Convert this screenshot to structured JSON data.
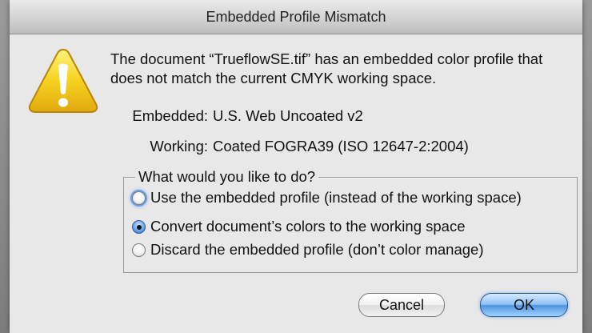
{
  "dialog": {
    "title": "Embedded Profile Mismatch",
    "message": "The document “TrueflowSE.tif” has an embedded color profile that does not match the current CMYK working space.",
    "embedded_label": "Embedded:",
    "embedded_value": "U.S. Web Uncoated v2",
    "working_label": "Working:",
    "working_value": "Coated FOGRA39 (ISO 12647-2:2004)",
    "group_label": "What would you like to do?",
    "options": [
      {
        "label": "Use the embedded profile (instead of the working space)",
        "selected": false,
        "focused": true
      },
      {
        "label": "Convert document’s colors to the working space",
        "selected": true,
        "focused": false
      },
      {
        "label": "Discard the embedded profile (don’t color manage)",
        "selected": false,
        "focused": false
      }
    ],
    "buttons": {
      "cancel": "Cancel",
      "ok": "OK"
    },
    "icon": "warning-triangle-icon",
    "colors": {
      "warning_yellow": "#f6d21f",
      "accent_blue": "#4f92e1"
    }
  }
}
